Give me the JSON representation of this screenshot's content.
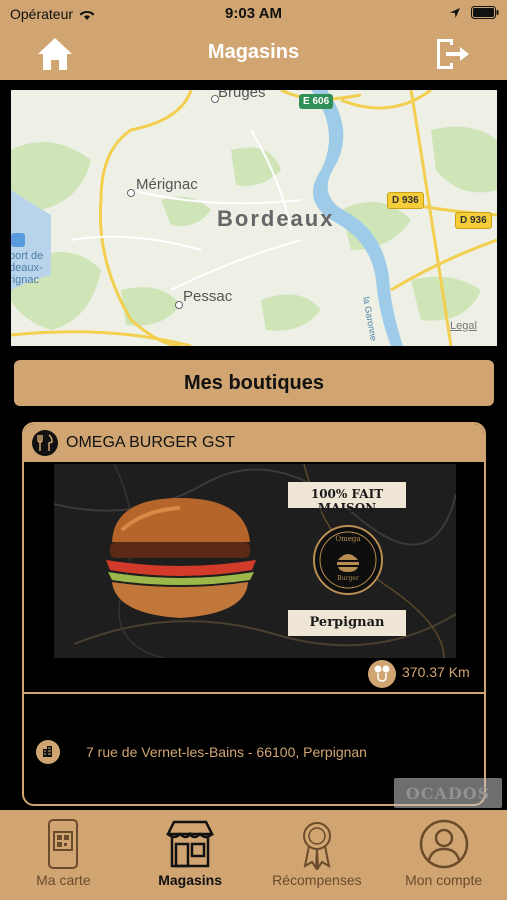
{
  "status": {
    "carrier": "Opérateur",
    "time": "9:03 AM"
  },
  "header": {
    "title": "Magasins",
    "home_icon": "home-icon",
    "logout_icon": "logout-icon"
  },
  "map": {
    "labels": {
      "bruges": "Bruges",
      "merignac": "Mérignac",
      "bordeaux": "Bordeaux",
      "pessac": "Pessac",
      "airport": "port de\ndeaux-\nrignac",
      "garonne": "la Garonne",
      "legal": "Legal"
    },
    "roads": {
      "e606": "E 606",
      "d936a": "D 936",
      "d936b": "D 936"
    }
  },
  "section": {
    "label": "Mes boutiques"
  },
  "store": {
    "name": "OMEGA BURGER GST",
    "image": {
      "banner_top": "100% FAIT MAISON",
      "banner_bottom": "Perpignan",
      "logo_top": "Omega",
      "logo_bottom": "Burger"
    },
    "distance": "370.37 Km",
    "address": "7 rue de Vernet-les-Bains - 66100, Perpignan"
  },
  "watermark": "OCADOS",
  "tabs": [
    {
      "label": "Ma carte",
      "icon": "qr-card-icon",
      "active": false
    },
    {
      "label": "Magasins",
      "icon": "store-icon",
      "active": true
    },
    {
      "label": "Récompenses",
      "icon": "medal-icon",
      "active": false
    },
    {
      "label": "Mon compte",
      "icon": "user-icon",
      "active": false
    }
  ],
  "colors": {
    "accent": "#d0a572",
    "background": "#000000",
    "text_dark": "#111111"
  }
}
